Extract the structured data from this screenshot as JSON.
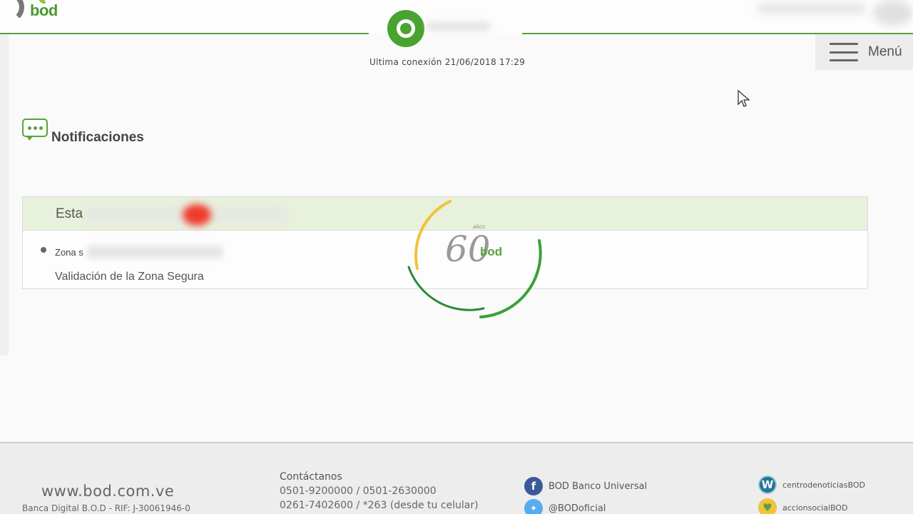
{
  "header": {
    "last_connection": "Ultima conexión 21/06/2018 17:29",
    "menu_label": "Menú",
    "logo_text": "bod"
  },
  "notifications": {
    "title": "Notificaciones",
    "panel_header": "Esta",
    "item_prefix": "Zona s",
    "item_description": "Validación de la Zona Segura"
  },
  "loader": {
    "label_anos": "AÑOS",
    "label_number": "60",
    "label_brand": "bod"
  },
  "footer": {
    "website": "www.bod.com.ve",
    "rif": "Banca Digital B.O.D - RIF: J-30061946-0",
    "contact_title": "Contáctanos",
    "phone_line_1": "0501-9200000 / 0501-2630000",
    "phone_line_2": "0261-7402600 / *263 (desde tu celular)",
    "social": {
      "facebook": "BOD Banco Universal",
      "twitter": "@BODoficial",
      "wordpress": "centrodenoticiasBOD",
      "social_action": "accionsocialBOD"
    }
  },
  "colors": {
    "brand_green": "#49a331",
    "panel_header_bg": "#e8f1dc",
    "loader_yellow": "#f2c23a",
    "loader_green": "#2a8a3a",
    "facebook": "#3b5998",
    "twitter": "#55acee",
    "wordpress": "#21759b"
  },
  "icons": {
    "user": "user-ring-icon",
    "menu": "hamburger-icon",
    "notifications": "chat-bubble-icon",
    "facebook": "facebook-icon",
    "twitter": "twitter-icon",
    "wordpress": "wordpress-icon",
    "social_action": "heart-icon"
  }
}
